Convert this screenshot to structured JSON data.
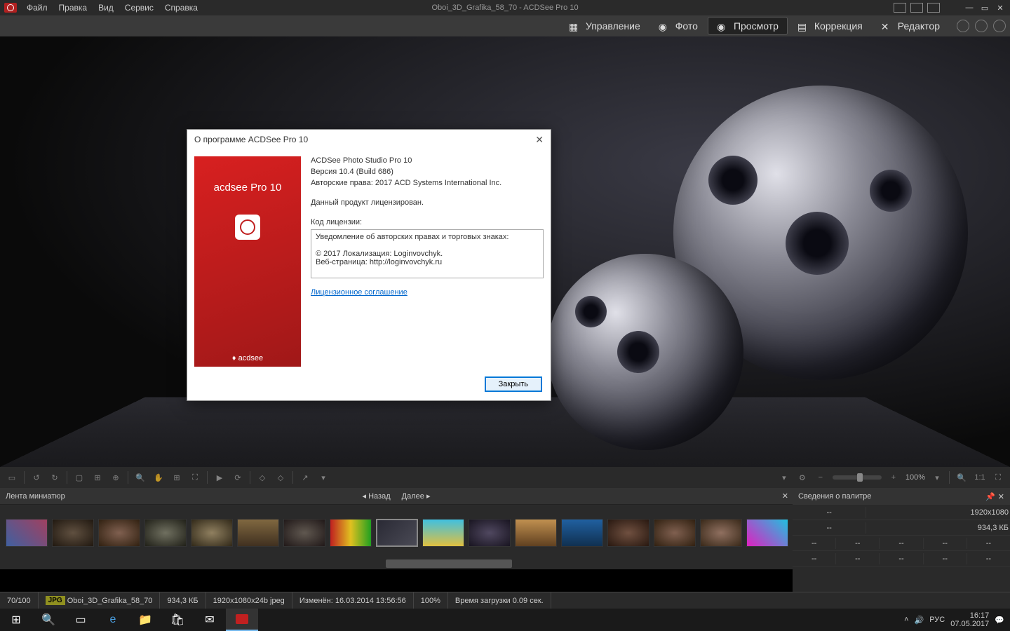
{
  "menubar": {
    "items": [
      "Файл",
      "Правка",
      "Вид",
      "Сервис",
      "Справка"
    ],
    "title": "Oboi_3D_Grafika_58_70 - ACDSee Pro 10"
  },
  "modes": {
    "manage": "Управление",
    "photo": "Фото",
    "view": "Просмотр",
    "correction": "Коррекция",
    "editor": "Редактор"
  },
  "view_toolbar": {
    "zoom": "100%"
  },
  "thumb_header": {
    "title": "Лента миниатюр",
    "back": "Назад",
    "forward": "Далее"
  },
  "palette": {
    "title": "Сведения о палитре",
    "dims": "1920x1080",
    "size": "934,3 КБ",
    "dash": "--"
  },
  "status": {
    "count": "70/100",
    "format": "JPG",
    "filename": "Oboi_3D_Grafika_58_70",
    "filesize": "934,3 КБ",
    "dims": "1920x1080x24b jpeg",
    "modified": "Изменён: 16.03.2014 13:56:56",
    "zoom": "100%",
    "loadtime": "Время загрузки 0.09 сек."
  },
  "taskbar": {
    "lang": "РУС",
    "time": "16:17",
    "date": "07.05.2017"
  },
  "dialog": {
    "title": "О программе ACDSee Pro 10",
    "left_logo": "acdsee Pro 10",
    "left_brand": "♦ acdsee",
    "product": "ACDSee Photo Studio Pro 10",
    "version": "Версия 10.4 (Build 686)",
    "copyright": "Авторские права: 2017 ACD Systems International Inc.",
    "licensed": "Данный продукт лицензирован.",
    "license_code": "Код лицензии:",
    "notice_title": "Уведомление об авторских правах и торговых знаках:",
    "notice_l1": "© 2017 Локализация: Loginvovchyk.",
    "notice_l2": "Веб-страница: http://loginvovchyk.ru",
    "agreement": "Лицензионное соглашение",
    "close": "Закрыть"
  }
}
